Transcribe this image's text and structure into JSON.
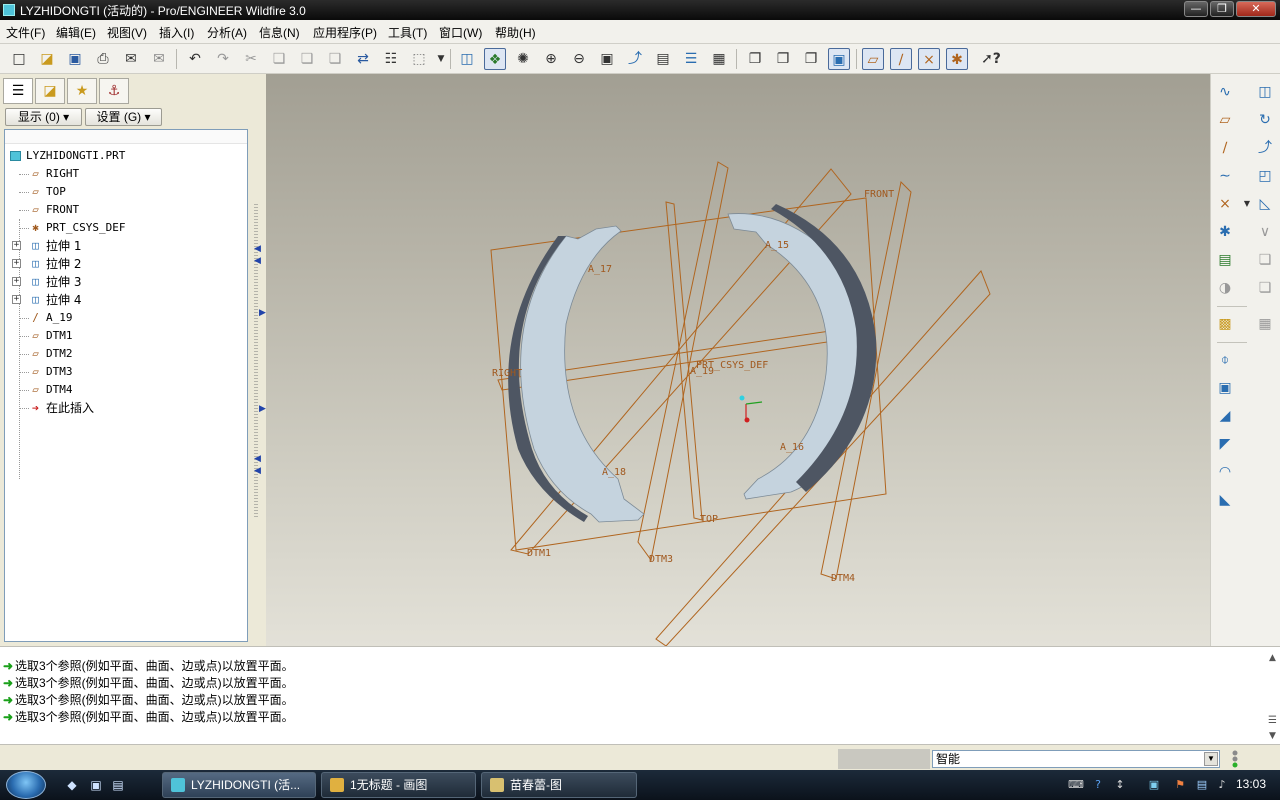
{
  "window": {
    "title": "LYZHIDONGTI (活动的) - Pro/ENGINEER Wildfire 3.0"
  },
  "menu": [
    "文件(F)",
    "编辑(E)",
    "视图(V)",
    "插入(I)",
    "分析(A)",
    "信息(N)",
    "应用程序(P)",
    "工具(T)",
    "窗口(W)",
    "帮助(H)"
  ],
  "left_panel": {
    "show_button": "显示 (0)",
    "settings_button": "设置 (G)",
    "tree": [
      {
        "label": "LYZHIDONGTI.PRT",
        "icon": "part-icon"
      },
      {
        "label": "RIGHT",
        "icon": "datum-plane-icon"
      },
      {
        "label": "TOP",
        "icon": "datum-plane-icon"
      },
      {
        "label": "FRONT",
        "icon": "datum-plane-icon"
      },
      {
        "label": "PRT_CSYS_DEF",
        "icon": "csys-icon"
      },
      {
        "label": "拉伸 1",
        "icon": "extrude-icon",
        "expandable": true
      },
      {
        "label": "拉伸 2",
        "icon": "extrude-icon",
        "expandable": true
      },
      {
        "label": "拉伸 3",
        "icon": "extrude-icon",
        "expandable": true
      },
      {
        "label": "拉伸 4",
        "icon": "extrude-icon",
        "expandable": true
      },
      {
        "label": "A_19",
        "icon": "datum-axis-icon"
      },
      {
        "label": "DTM1",
        "icon": "datum-plane-icon"
      },
      {
        "label": "DTM2",
        "icon": "datum-plane-icon"
      },
      {
        "label": "DTM3",
        "icon": "datum-plane-icon"
      },
      {
        "label": "DTM4",
        "icon": "datum-plane-icon"
      },
      {
        "label": "在此插入",
        "icon": "insert-here-arrow-icon"
      }
    ]
  },
  "viewport": {
    "labels": {
      "front": "FRONT",
      "right": "RIGHT",
      "top": "TOP",
      "dtm1": "DTM1",
      "dtm3": "DTM3",
      "dtm4": "DTM4",
      "csys": "PRT_CSYS_DEF",
      "a15": "A_15",
      "a16": "A_16",
      "a17": "A_17",
      "a18": "A_18",
      "a19": "A_19"
    },
    "colors": {
      "datum": "#b0651f",
      "part": "#c5d3de",
      "part_shadow": "#4e5663"
    }
  },
  "messages": [
    "选取3个参照(例如平面、曲面、边或点)以放置平面。",
    "选取3个参照(例如平面、曲面、边或点)以放置平面。",
    "选取3个参照(例如平面、曲面、边或点)以放置平面。",
    "选取3个参照(例如平面、曲面、边或点)以放置平面。"
  ],
  "status": {
    "filter_value": "智能"
  },
  "taskbar": {
    "tasks": [
      "LYZHIDONGTI (活...",
      "1无标题 - 画图",
      "苗春蕾-图"
    ],
    "clock": "13:03"
  }
}
